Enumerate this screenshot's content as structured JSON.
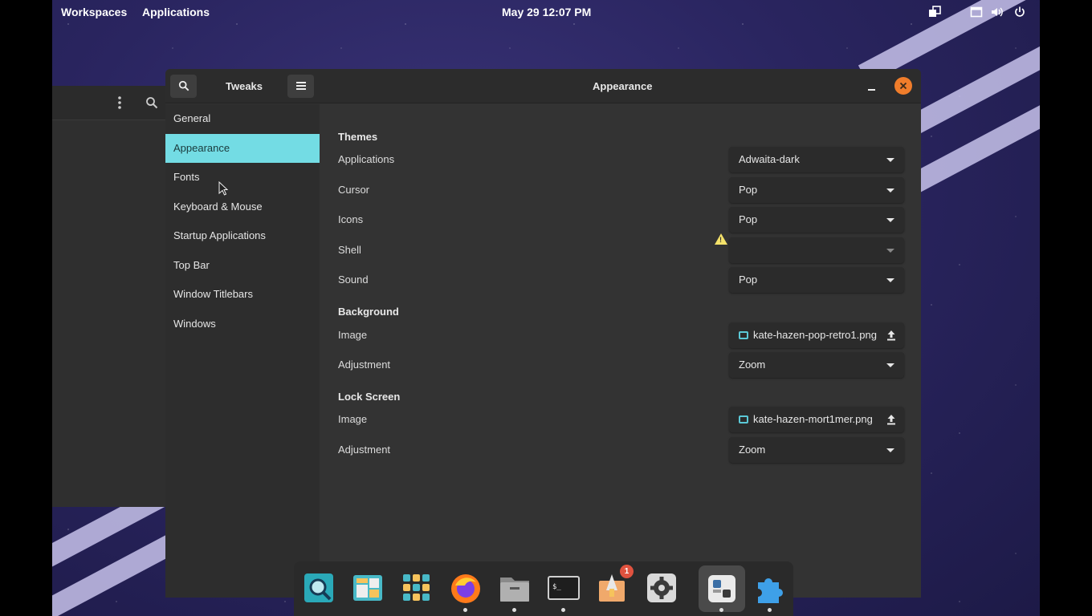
{
  "topbar": {
    "workspaces": "Workspaces",
    "applications": "Applications",
    "clock": "May 29  12:07 PM"
  },
  "window": {
    "app_title": "Tweaks",
    "page_title": "Appearance"
  },
  "sidebar": {
    "items": [
      {
        "label": "General"
      },
      {
        "label": "Appearance"
      },
      {
        "label": "Fonts"
      },
      {
        "label": "Keyboard & Mouse"
      },
      {
        "label": "Startup Applications"
      },
      {
        "label": "Top Bar"
      },
      {
        "label": "Window Titlebars"
      },
      {
        "label": "Windows"
      }
    ],
    "active": "Appearance"
  },
  "themes": {
    "section": "Themes",
    "applications": {
      "label": "Applications",
      "value": "Adwaita-dark"
    },
    "cursor": {
      "label": "Cursor",
      "value": "Pop"
    },
    "icons": {
      "label": "Icons",
      "value": "Pop"
    },
    "shell": {
      "label": "Shell",
      "value": ""
    },
    "sound": {
      "label": "Sound",
      "value": "Pop"
    }
  },
  "background": {
    "section": "Background",
    "image": {
      "label": "Image",
      "value": "kate-hazen-pop-retro1.png"
    },
    "adjustment": {
      "label": "Adjustment",
      "value": "Zoom"
    }
  },
  "lockscreen": {
    "section": "Lock Screen",
    "image": {
      "label": "Image",
      "value": "kate-hazen-mort1mer.png"
    },
    "adjustment": {
      "label": "Adjustment",
      "value": "Zoom"
    }
  },
  "dock": {
    "notification_count": "1"
  },
  "colors": {
    "accent": "#73dce4",
    "close_button": "#f07d2b",
    "warning": "#f5e26a"
  }
}
